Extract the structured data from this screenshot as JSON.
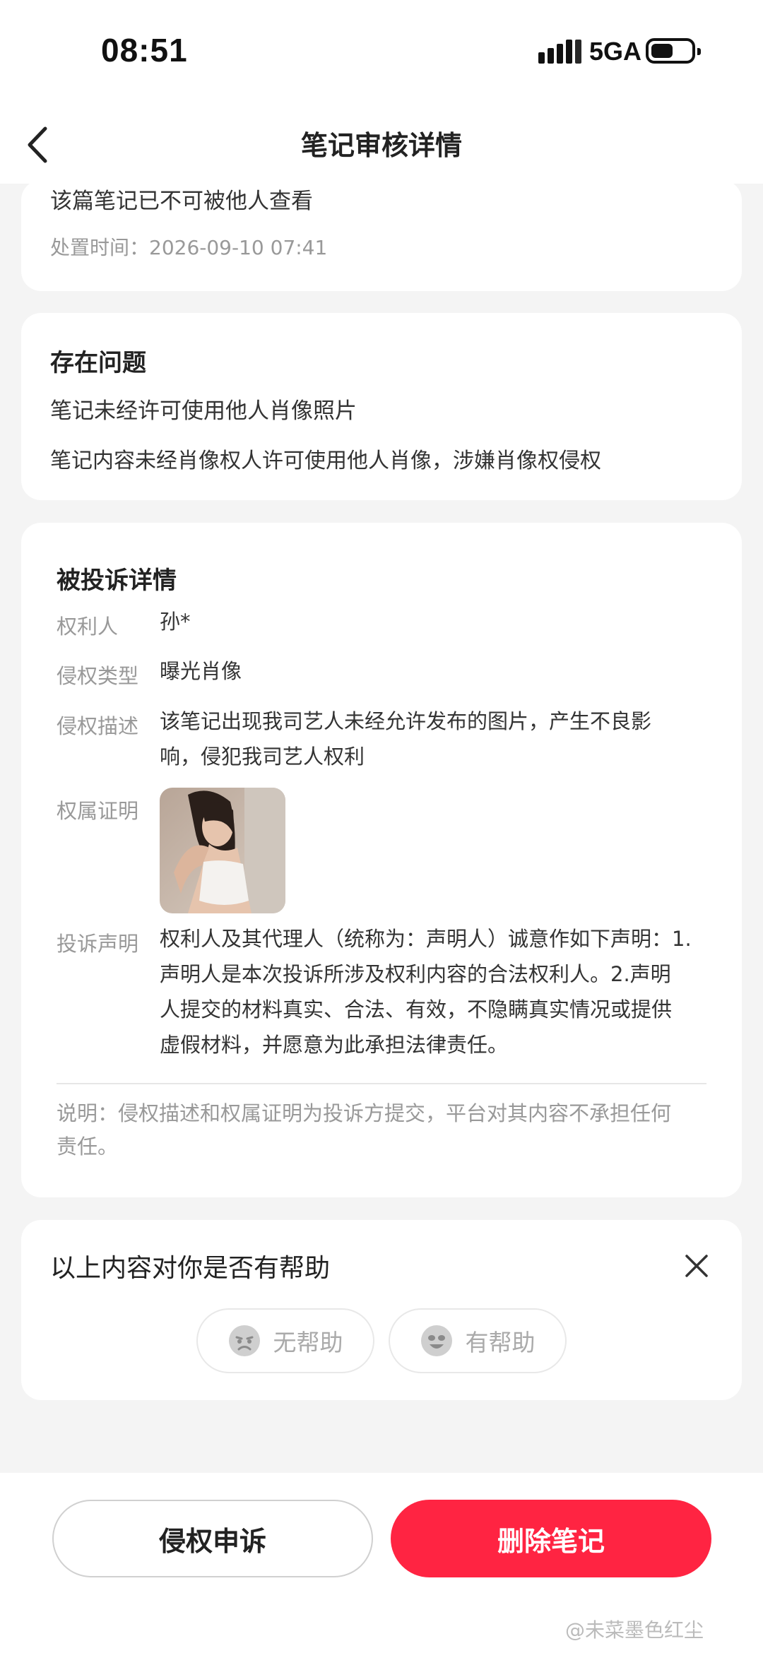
{
  "status_bar": {
    "time": "08:51",
    "network": "5GA"
  },
  "nav": {
    "title": "笔记审核详情"
  },
  "status_card": {
    "message": "该篇笔记已不可被他人查看",
    "handled_time": "处置时间：2026-09-10 07:41"
  },
  "problem_card": {
    "heading": "存在问题",
    "issue": "笔记未经许可使用他人肖像照片",
    "description": "笔记内容未经肖像权人许可使用他人肖像，涉嫌肖像权侵权"
  },
  "complaint_card": {
    "heading": "被投诉详情",
    "rights_holder_label": "权利人",
    "rights_holder": "孙*",
    "type_label": "侵权类型",
    "type": "曝光肖像",
    "desc_label": "侵权描述",
    "desc_line1": "该笔记出现我司艺人未经允许发布的图片，产生不良影",
    "desc_line2": "响，侵犯我司艺人权利",
    "proof_label": "权属证明",
    "statement_label": "投诉声明",
    "statement_line1": "权利人及其代理人（统称为：声明人）诚意作如下声明：1.",
    "statement_line2": "声明人是本次投诉所涉及权利内容的合法权利人。2.声明",
    "statement_line3": "人提交的材料真实、合法、有效，不隐瞒真实情况或提供",
    "statement_line4": "虚假材料，并愿意为此承担法律责任。",
    "note_line1": "说明：侵权描述和权属证明为投诉方提交，平台对其内容不承担任何",
    "note_line2": "责任。"
  },
  "feedback": {
    "question": "以上内容对你是否有帮助",
    "no_help": "无帮助",
    "helpful": "有帮助"
  },
  "actions": {
    "appeal": "侵权申诉",
    "delete": "删除笔记"
  },
  "watermark": "@未菜墨色红尘",
  "colors": {
    "accent": "#ff2442",
    "background": "#f4f4f4"
  }
}
